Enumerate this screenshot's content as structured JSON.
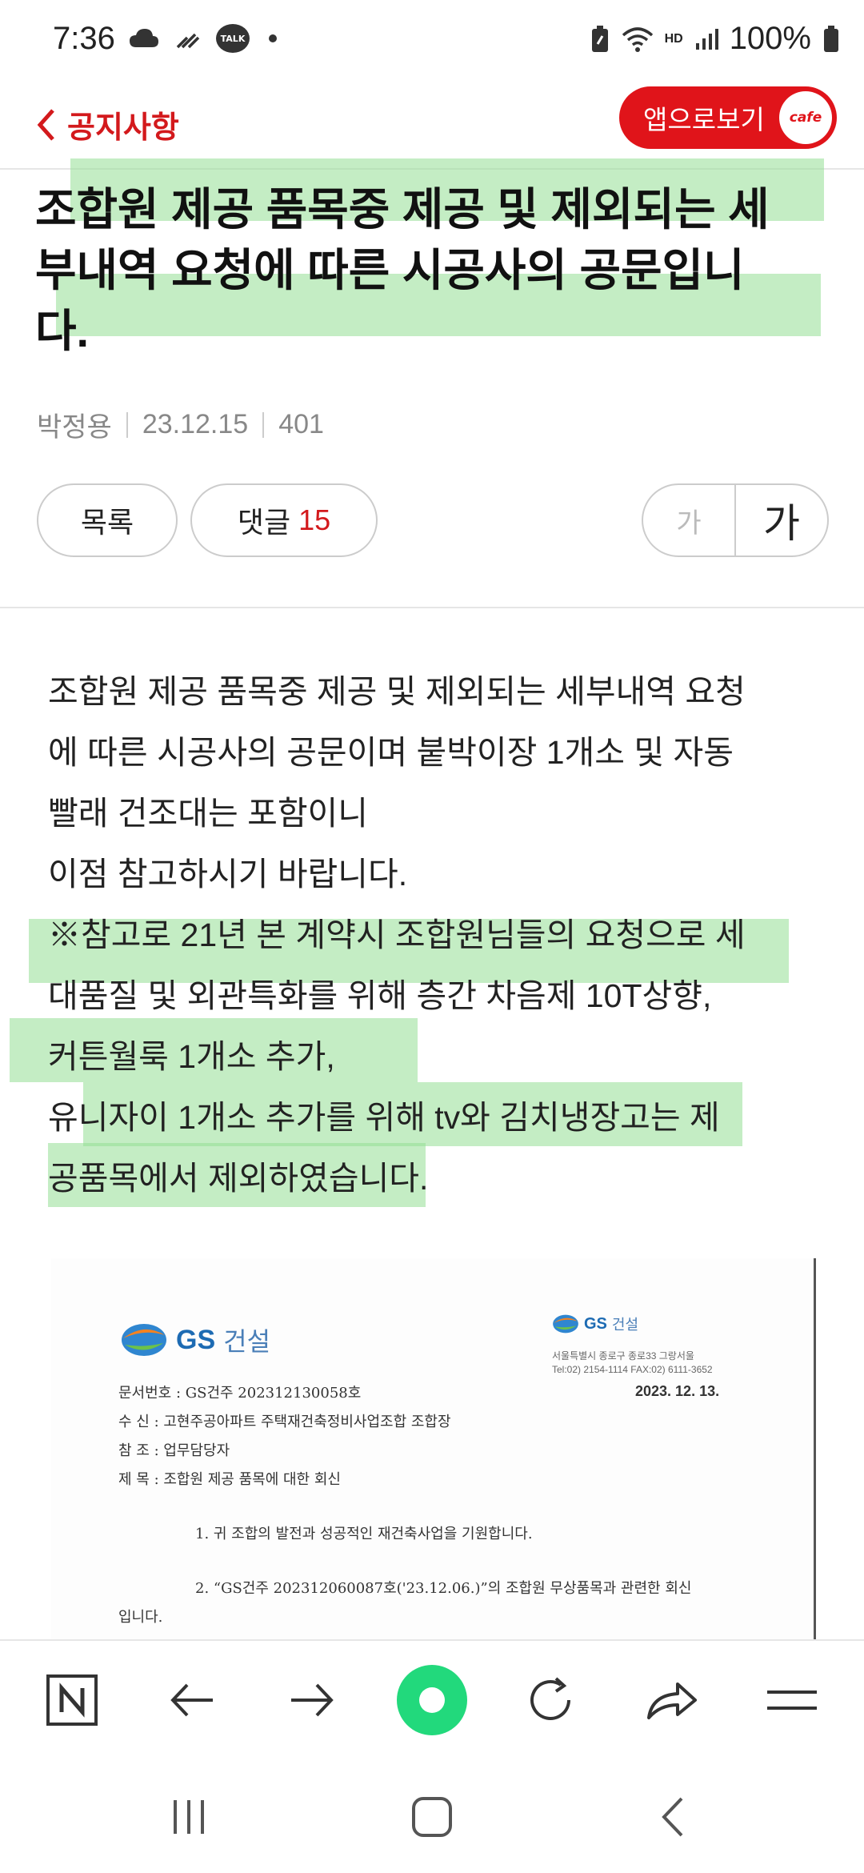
{
  "status_bar": {
    "time": "7:36",
    "battery": "100%",
    "talk_badge": "TALK",
    "hd_label": "HD"
  },
  "header": {
    "back_label": "공지사항",
    "app_button_label": "앱으로보기",
    "cafe_badge": "cafe"
  },
  "post": {
    "title_lines": [
      "조합원 제공 품목중 제공 및 제외되는 세",
      "부내역 요청에 따른 시공사의 공문입니",
      "다."
    ],
    "author": "박정용",
    "date": "23.12.15",
    "views": "401",
    "list_button": "목록",
    "comment_label": "댓글",
    "comment_count": "15",
    "font_small": "가",
    "font_large": "가",
    "body_lines": [
      "조합원 제공 품목중 제공 및 제외되는 세부내역 요청",
      "에 따른 시공사의 공문이며 붙박이장 1개소 및 자동",
      "빨래 건조대는 포함이니",
      "이점 참고하시기 바랍니다.",
      "※참고로 21년 본 계약시 조합원님들의 요청으로 세",
      "대품질 및 외관특화를 위해  층간 차음제 10T상향,",
      "커튼월룩 1개소 추가,",
      "유니자이 1개소 추가를 위해 tv와 김치냉장고는 제",
      "공품목에서 제외하였습니다."
    ]
  },
  "document": {
    "logo_text": "GS",
    "logo_text2": "건설",
    "address_lines": [
      "서울특별시 종로구 종로33 그랑서울",
      "Tel:02) 2154-1114   FAX:02) 6111-3652"
    ],
    "doc_date": "2023. 12. 13.",
    "lines": [
      "문서번호 : GS건주  202312130058호",
      "수      신 : 고현주공아파트 주택재건축정비사업조합 조합장",
      "참      조 : 업무담당자",
      "제      목 : 조합원 제공 품목에 대한 회신",
      "1. 귀 조합의 발전과 성공적인 재건축사업을 기원합니다.",
      "2. “GS건주 202312060087호('23.12.06.)”의 조합원 무상품목과 관련한 회신",
      "입니다."
    ]
  },
  "toolbar": {
    "items": [
      "naver-home",
      "back",
      "forward",
      "green-dot",
      "reload",
      "share",
      "menu"
    ]
  },
  "colors": {
    "accent_red": "#d3191c",
    "highlight": "#94de94",
    "green_button": "#22d97c"
  }
}
